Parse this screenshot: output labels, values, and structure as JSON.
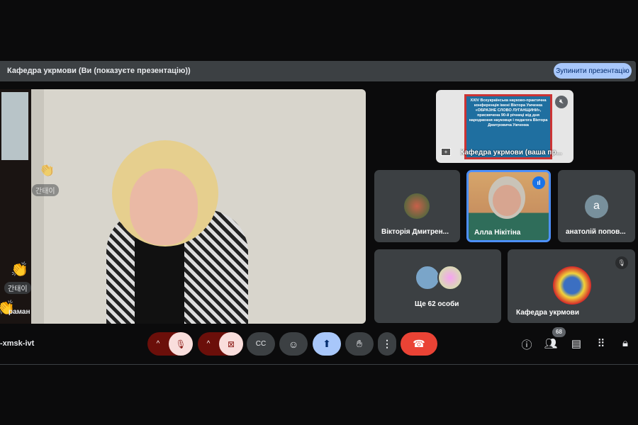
{
  "banner": {
    "title": "Кафедра укрмови (Ви (показуєте презентацію))",
    "stop_button": "Зупинити презентацію"
  },
  "main_video": {
    "reactions": [
      {
        "emoji": "👏",
        "name": "간태이"
      },
      {
        "emoji": "👏",
        "name": "간태이"
      },
      {
        "emoji": "👏",
        "name": "раман"
      }
    ]
  },
  "tiles": {
    "presentation": {
      "name": "Кафедра укрмови (ваша пр...",
      "slide_text": "XXIV Всеукраїнська науково-практична конференція імені Віктора Ужченка «ОБРАЗНЕ СЛОВО ЛУГАНЩИНИ», присвячена 90-й річниці від дня народження науковця і педагога Віктора Дмитровича Ужченка"
    },
    "viktoria": {
      "name": "Вікторія Дмитрен..."
    },
    "alla": {
      "name": "Алла Нікітіна"
    },
    "anatoliy": {
      "name": "анатолій попов...",
      "initial": "a"
    },
    "others": {
      "name": "Ще 62 особи"
    },
    "kafedra": {
      "name": "Кафедра укрмови"
    }
  },
  "bottom": {
    "meeting_code": "-xmsk-ivt",
    "participants_count": "68"
  },
  "colors": {
    "end_call": "#ea4335",
    "accent": "#a8c7fa",
    "muted_bg": "#f9dedc",
    "muted_chevron": "#5c0e08"
  }
}
